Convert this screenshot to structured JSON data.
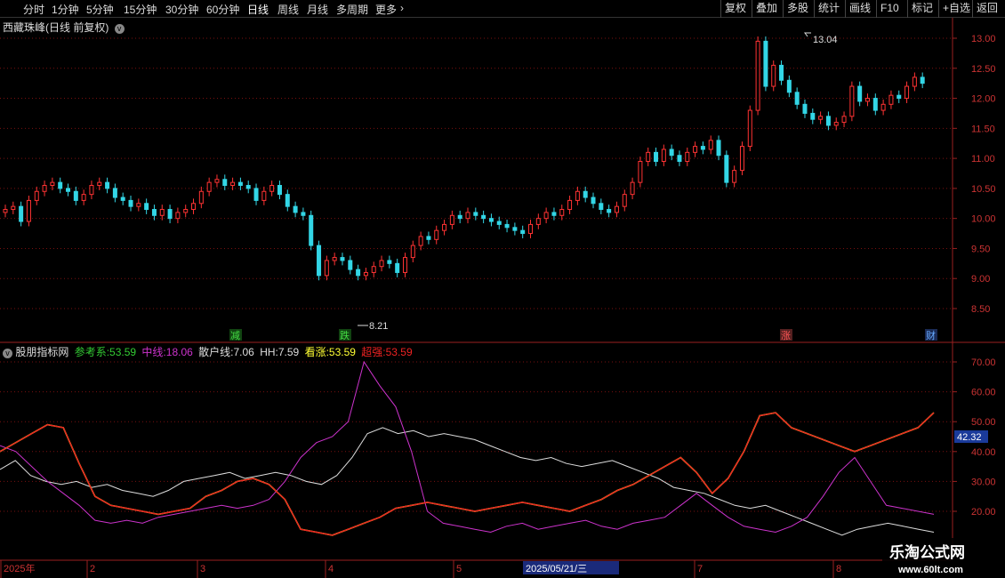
{
  "toolbar": {
    "items": [
      "分时",
      "1分钟",
      "5分钟",
      "15分钟",
      "30分钟",
      "60分钟",
      "日线",
      "周线",
      "月线",
      "多周期",
      "更多"
    ],
    "active_index": 6,
    "right_buttons": [
      "复权",
      "叠加",
      "多股",
      "统计",
      "画线",
      "F10",
      "标记",
      "+自选",
      "返回"
    ]
  },
  "main_panel": {
    "title": "西藏珠峰(日线 前复权)",
    "price_axis": [
      "13.00",
      "12.50",
      "12.00",
      "11.50",
      "11.00",
      "10.50",
      "10.00",
      "9.50",
      "9.00",
      "8.50"
    ],
    "high_label": "13.04",
    "low_label": "8.21",
    "markers": [
      {
        "text": "减",
        "color": "#2e8b2e"
      },
      {
        "text": "跌",
        "color": "#2e8b2e"
      },
      {
        "text": "涨",
        "color": "#c02020"
      },
      {
        "text": "财",
        "color": "#2060c0"
      }
    ]
  },
  "indicator_panel": {
    "name": "股朋指标网",
    "legend": [
      {
        "label": "参考系:",
        "value": "53.59",
        "color": "#33cc33"
      },
      {
        "label": "中线:",
        "value": "18.06",
        "color": "#cc33cc"
      },
      {
        "label": "散户线:",
        "value": "7.06",
        "color": "#dddddd"
      },
      {
        "label": "HH:",
        "value": "7.59",
        "color": "#dddddd"
      },
      {
        "label": "看涨:",
        "value": "53.59",
        "color": "#ffff33"
      },
      {
        "label": "超强:",
        "value": "53.59",
        "color": "#ee2222"
      }
    ],
    "axis": [
      "70.00",
      "60.00",
      "50.00",
      "40.00",
      "30.00",
      "20.00"
    ],
    "current_value": "42.32"
  },
  "date_axis": [
    "2025年",
    "2",
    "3",
    "4",
    "5",
    "2025/05/21/三",
    "7",
    "8"
  ],
  "watermark": {
    "title": "乐淘公式网",
    "url": "www.60lt.com"
  },
  "colors": {
    "up": "#ff3333",
    "down": "#33d6e6",
    "grid": "#7a1010",
    "axis": "#9a2020"
  }
}
